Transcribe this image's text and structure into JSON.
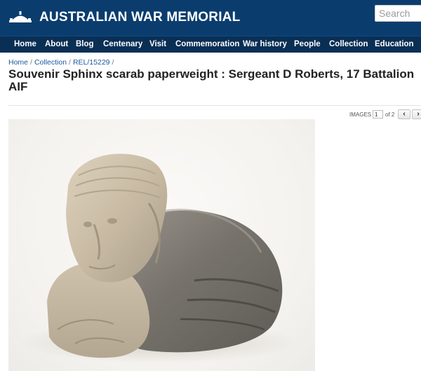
{
  "header": {
    "site_title": "AUSTRALIAN WAR MEMORIAL",
    "logo_icon": "awm-dome-logo-icon",
    "search_placeholder": "Search"
  },
  "nav": {
    "items": [
      {
        "label": "Home"
      },
      {
        "label": "About"
      },
      {
        "label": "Blog"
      },
      {
        "label": "Centenary"
      },
      {
        "label": "Visit"
      },
      {
        "label": "Commemoration"
      },
      {
        "label": "War history"
      },
      {
        "label": "People"
      },
      {
        "label": "Collection"
      },
      {
        "label": "Education"
      }
    ]
  },
  "breadcrumb": {
    "items": [
      "Home",
      "Collection",
      "REL/15229"
    ],
    "separator": "/"
  },
  "page": {
    "title": "Souvenir Sphinx scarab paperweight : Sergeant D Roberts, 17 Battalion AIF"
  },
  "pager": {
    "label": "IMAGES",
    "current": "1",
    "of_text": "of 2",
    "prev_icon": "chevron-left-icon",
    "next_icon": "chevron-right-icon"
  },
  "colors": {
    "header_bg": "#0a3d6e",
    "nav_bg": "#0a2f55",
    "link": "#1b5aa0"
  }
}
